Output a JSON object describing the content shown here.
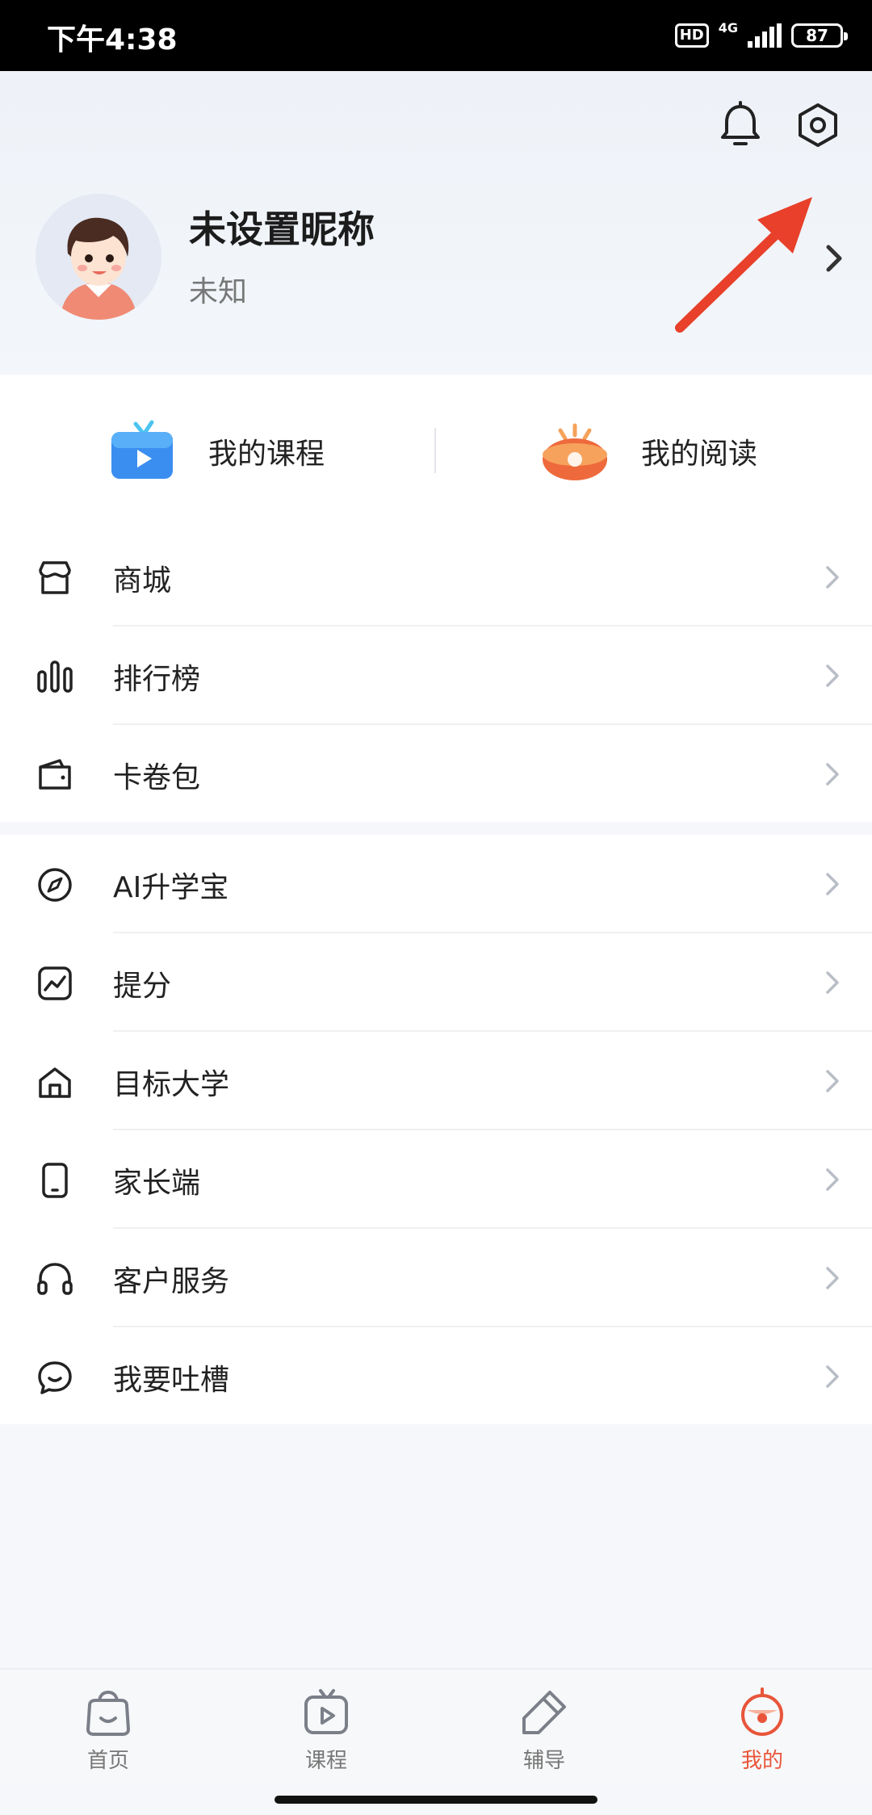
{
  "status_bar": {
    "time": "下午4:38",
    "hd": "HD",
    "network": "4G",
    "battery": "87"
  },
  "header": {
    "nickname": "未设置昵称",
    "gender": "未知",
    "icons": [
      "bell-icon",
      "gear-icon",
      "chevron-right-icon"
    ],
    "annotation_color": "#e8402a"
  },
  "quick_entries": [
    {
      "label": "我的课程",
      "icon": "tv-icon"
    },
    {
      "label": "我的阅读",
      "icon": "eye-icon"
    }
  ],
  "menu_group_1": [
    {
      "label": "商城",
      "icon": "shop-icon"
    },
    {
      "label": "排行榜",
      "icon": "ranking-bars-icon"
    },
    {
      "label": "卡卷包",
      "icon": "wallet-icon"
    }
  ],
  "menu_group_2": [
    {
      "label": "AI升学宝",
      "icon": "compass-icon"
    },
    {
      "label": "提分",
      "icon": "chart-line-icon"
    },
    {
      "label": "目标大学",
      "icon": "building-icon"
    },
    {
      "label": "家长端",
      "icon": "phone-icon"
    },
    {
      "label": "客户服务",
      "icon": "headset-icon"
    },
    {
      "label": "我要吐槽",
      "icon": "chat-bubble-icon"
    }
  ],
  "tabbar": [
    {
      "label": "首页",
      "icon": "home-bag-icon"
    },
    {
      "label": "课程",
      "icon": "course-tv-icon"
    },
    {
      "label": "辅导",
      "icon": "pencil-tag-icon"
    },
    {
      "label": "我的",
      "icon": "mine-face-icon",
      "active": true
    }
  ],
  "colors": {
    "accent": "#e8553a",
    "text": "#222222",
    "muted": "#777777",
    "background": "#f5f7fa"
  }
}
